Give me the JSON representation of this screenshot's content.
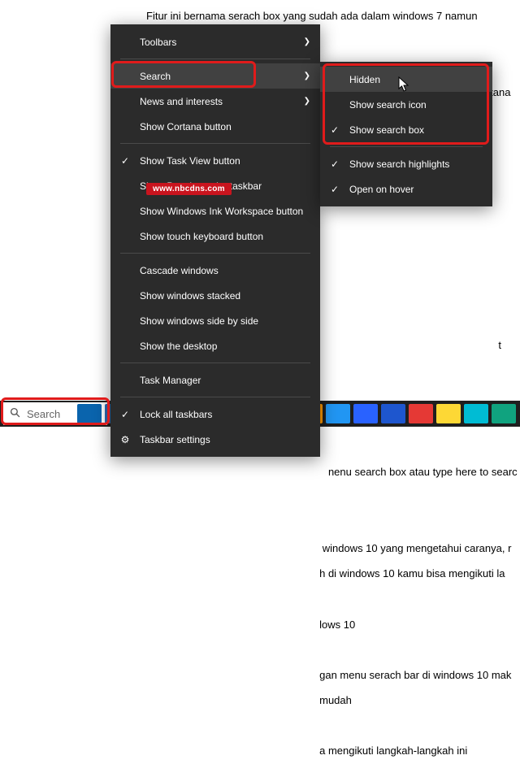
{
  "background_text": "Fitur ini bernama serach box yang sudah ada dalam windows 7 namun memang kita pergunakan\n\n                                                                    aga Type Here to search di cortana wind\n                                                                                                                        yang\n\n                                                                                                                        searc\n                                                                                                                        udah\n\n                                                                                                                        t nev\n\n                                                                                                                        fitur\n\n                                                              nenu search box atau type here to searc\n\n\n                                                            windows 10 yang mengetahui caranya, r\n                                                           h di windows 10 kamu bisa mengikuti la\n\n                                                           lows 10\n\n                                                           gan menu serach bar di windows 10 mak\n                                                           mudah\n\n                                                           a mengikuti langkah-langkah ini",
  "main_menu": {
    "toolbars": "Toolbars",
    "search": "Search",
    "news": "News and interests",
    "cortana": "Show Cortana button",
    "taskview": "Show Task View button",
    "people": "Show People on the taskbar",
    "ink": "Show Windows Ink Workspace button",
    "touchkb": "Show touch keyboard button",
    "cascade": "Cascade windows",
    "stacked": "Show windows stacked",
    "sidebyside": "Show windows side by side",
    "desktop": "Show the desktop",
    "taskmgr": "Task Manager",
    "lock": "Lock all taskbars",
    "settings": "Taskbar settings"
  },
  "submenu": {
    "hidden": "Hidden",
    "show_icon": "Show search icon",
    "show_box": "Show search box",
    "highlights": "Show search highlights",
    "on_hover": "Open on hover"
  },
  "taskbar": {
    "search_placeholder": "Search"
  },
  "watermark": "www.nbcdns.com",
  "icons": {
    "check": "✓",
    "gear": "⚙",
    "arrow": "❯",
    "search": "🔍"
  },
  "tb_colors": [
    "#0a64ad",
    "#2b6ab0",
    "#0f7a8c",
    "#6830a0",
    "#1271c4",
    "#ffffff",
    "#15a34a",
    "#1e88e5",
    "#ff9800",
    "#2196f3",
    "#2962ff",
    "#1e56ce",
    "#e53935",
    "#fdd835",
    "#00bcd4",
    "#10a37f"
  ]
}
